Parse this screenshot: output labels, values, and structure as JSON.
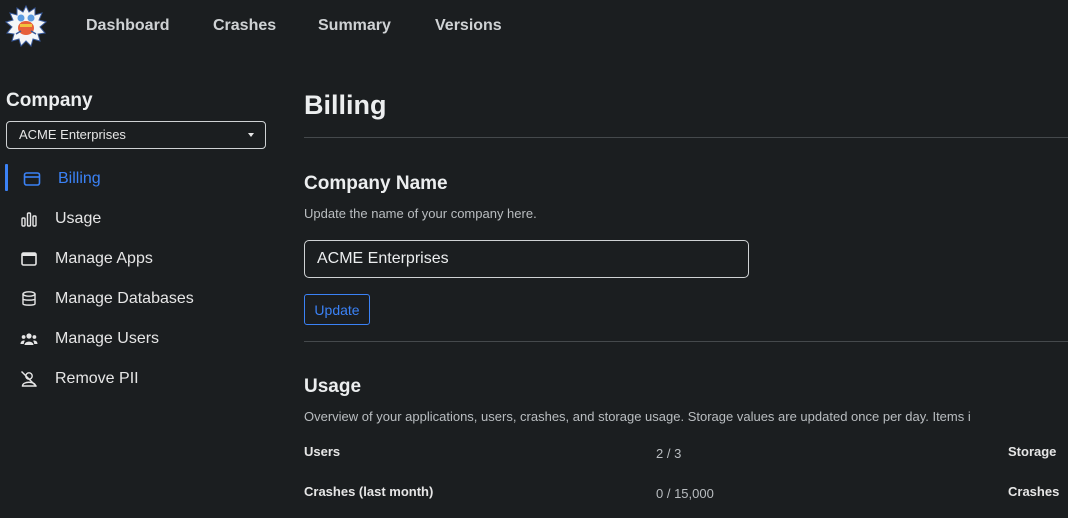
{
  "nav": {
    "items": [
      "Dashboard",
      "Crashes",
      "Summary",
      "Versions"
    ]
  },
  "sidebar": {
    "title": "Company",
    "company_select": "ACME Enterprises",
    "items": [
      {
        "label": "Billing",
        "icon": "credit-card-icon",
        "active": true
      },
      {
        "label": "Usage",
        "icon": "bar-chart-icon"
      },
      {
        "label": "Manage Apps",
        "icon": "window-icon"
      },
      {
        "label": "Manage Databases",
        "icon": "database-icon"
      },
      {
        "label": "Manage Users",
        "icon": "users-icon"
      },
      {
        "label": "Remove PII",
        "icon": "user-remove-icon"
      }
    ]
  },
  "main": {
    "title": "Billing",
    "company_name": {
      "heading": "Company Name",
      "description": "Update the name of your company here.",
      "value": "ACME Enterprises",
      "button": "Update"
    },
    "usage": {
      "heading": "Usage",
      "description": "Overview of your applications, users, crashes, and storage usage. Storage values are updated once per day. Items i",
      "rows": [
        {
          "label": "Users",
          "value": "2 / 3",
          "right_label": "Storage"
        },
        {
          "label": "Crashes (last month)",
          "value": "0 / 15,000",
          "right_label": "Crashes"
        }
      ]
    }
  },
  "colors": {
    "background": "#1b1e20",
    "accent": "#3b82f6"
  }
}
